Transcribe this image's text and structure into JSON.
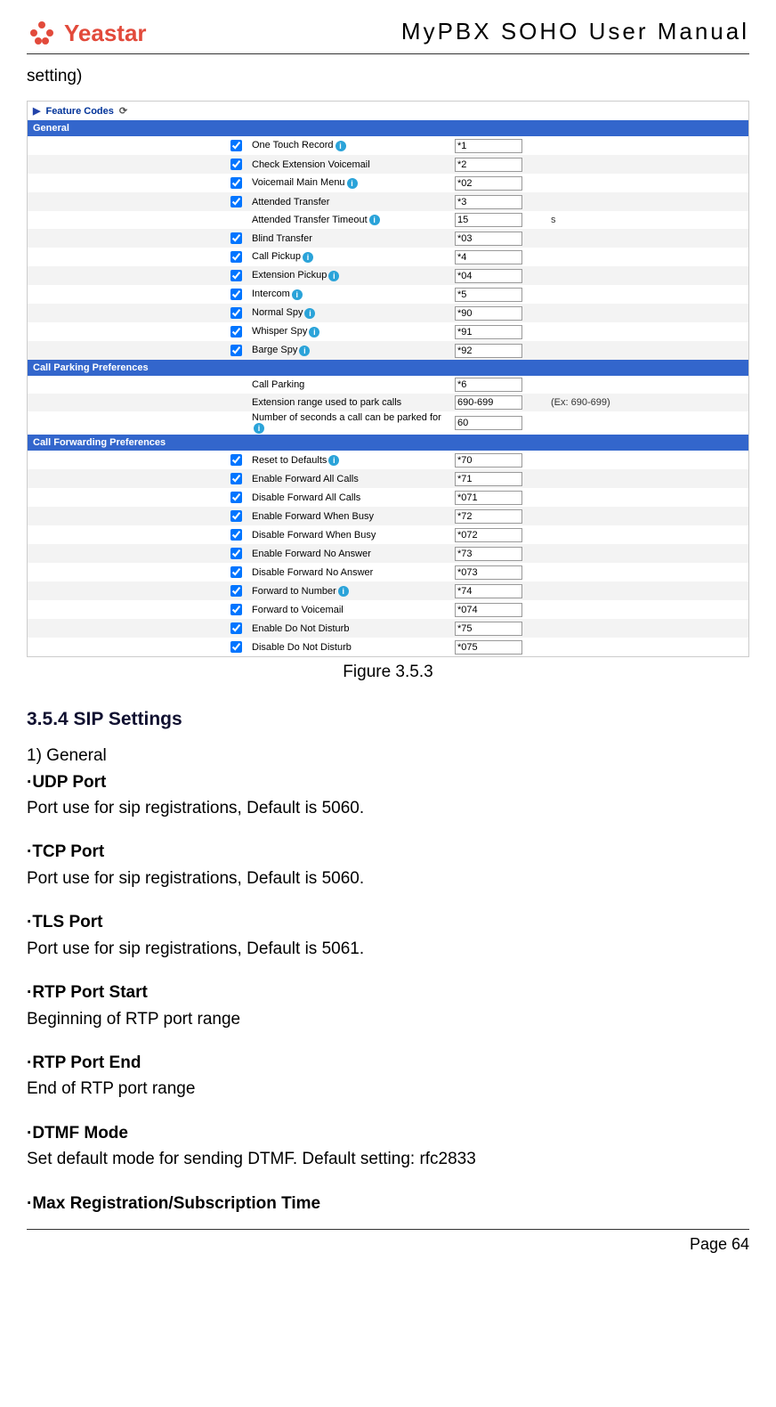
{
  "header": {
    "brand": "Yeastar",
    "docTitle": "MyPBX SOHO User Manual"
  },
  "topLine": "setting)",
  "breadcrumb": {
    "label": "Feature Codes",
    "hasGear": true
  },
  "sections": [
    {
      "title": "General",
      "rows": [
        {
          "cb": true,
          "label": "One Touch Record",
          "info": true,
          "val": "*1"
        },
        {
          "cb": true,
          "label": "Check Extension Voicemail",
          "info": false,
          "val": "*2"
        },
        {
          "cb": true,
          "label": "Voicemail Main Menu",
          "info": true,
          "val": "*02"
        },
        {
          "cb": true,
          "label": "Attended Transfer",
          "info": false,
          "val": "*3"
        },
        {
          "cb": null,
          "label": "Attended Transfer Timeout",
          "info": true,
          "val": "15",
          "after": "s"
        },
        {
          "cb": true,
          "label": "Blind Transfer",
          "info": false,
          "val": "*03"
        },
        {
          "cb": true,
          "label": "Call Pickup",
          "info": true,
          "val": "*4"
        },
        {
          "cb": true,
          "label": "Extension Pickup",
          "info": true,
          "val": "*04"
        },
        {
          "cb": true,
          "label": "Intercom",
          "info": true,
          "val": "*5"
        },
        {
          "cb": true,
          "label": "Normal Spy",
          "info": true,
          "val": "*90"
        },
        {
          "cb": true,
          "label": "Whisper Spy",
          "info": true,
          "val": "*91"
        },
        {
          "cb": true,
          "label": "Barge Spy",
          "info": true,
          "val": "*92"
        }
      ]
    },
    {
      "title": "Call Parking Preferences",
      "rows": [
        {
          "cb": null,
          "label": "Call Parking",
          "info": false,
          "val": "*6"
        },
        {
          "cb": null,
          "label": "Extension range used to park calls",
          "info": false,
          "val": "690-699",
          "after": "(Ex: 690-699)"
        },
        {
          "cb": null,
          "label": "Number of seconds a call can be parked for",
          "info": true,
          "val": "60"
        }
      ]
    },
    {
      "title": "Call Forwarding Preferences",
      "rows": [
        {
          "cb": true,
          "label": "Reset to Defaults",
          "info": true,
          "val": "*70"
        },
        {
          "cb": true,
          "label": "Enable Forward All Calls",
          "info": false,
          "val": "*71"
        },
        {
          "cb": true,
          "label": "Disable Forward All Calls",
          "info": false,
          "val": "*071"
        },
        {
          "cb": true,
          "label": "Enable Forward When Busy",
          "info": false,
          "val": "*72"
        },
        {
          "cb": true,
          "label": "Disable Forward When Busy",
          "info": false,
          "val": "*072"
        },
        {
          "cb": true,
          "label": "Enable Forward No Answer",
          "info": false,
          "val": "*73"
        },
        {
          "cb": true,
          "label": "Disable Forward No Answer",
          "info": false,
          "val": "*073"
        },
        {
          "cb": true,
          "label": "Forward to Number",
          "info": true,
          "val": "*74"
        },
        {
          "cb": true,
          "label": "Forward to Voicemail",
          "info": false,
          "val": "*074"
        },
        {
          "cb": true,
          "label": "Enable Do Not Disturb",
          "info": false,
          "val": "*75"
        },
        {
          "cb": true,
          "label": "Disable Do Not Disturb",
          "info": false,
          "val": "*075"
        }
      ]
    }
  ],
  "figCaption": "Figure 3.5.3",
  "sip": {
    "heading": "3.5.4 SIP Settings",
    "sub1": "1) General",
    "items": [
      {
        "title": "·UDP Port",
        "desc": "Port use for sip registrations, Default is 5060."
      },
      {
        "title": "·TCP Port",
        "desc": "Port use for sip registrations, Default is 5060."
      },
      {
        "title": "·TLS Port",
        "desc": "Port use for sip registrations, Default is 5061."
      },
      {
        "title": "·RTP Port Start",
        "desc": "Beginning of RTP port range"
      },
      {
        "title": "·RTP Port End",
        "desc": "End of RTP port range"
      },
      {
        "title": "·DTMF Mode",
        "desc": "Set default mode for sending DTMF. Default setting: rfc2833"
      },
      {
        "title": "·Max Registration/Subscription Time",
        "desc": ""
      }
    ]
  },
  "footer": {
    "pageLabel": "Page 64"
  }
}
